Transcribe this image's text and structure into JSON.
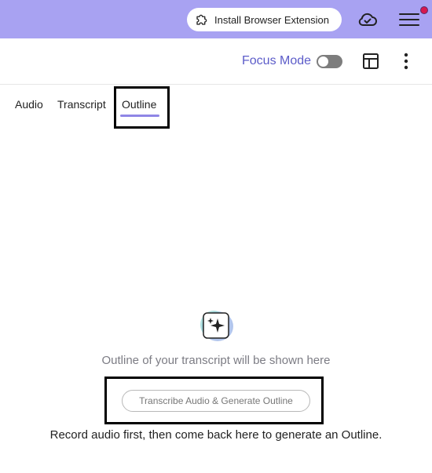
{
  "topbar": {
    "extension_button_label": "Install Browser Extension",
    "colors": {
      "background": "#a8a2f2",
      "notification_dot": "#d6184e"
    }
  },
  "toolbar": {
    "focus_mode_label": "Focus Mode",
    "focus_mode_enabled": false,
    "accent_color": "#5c5cc9"
  },
  "tabs": {
    "items": [
      {
        "label": "Audio",
        "active": false
      },
      {
        "label": "Transcript",
        "active": false
      },
      {
        "label": "Outline",
        "active": true
      }
    ],
    "active_underline_color": "#8f86e6"
  },
  "outline": {
    "empty_message": "Outline of your transcript will be shown here",
    "generate_button_label": "Transcribe Audio & Generate Outline",
    "hint": "Record audio first, then come back here to generate an Outline."
  },
  "icons": {
    "extension": "puzzle-icon",
    "cloud": "cloud-check-icon",
    "menu": "hamburger-menu-icon",
    "layout": "layout-panel-icon",
    "more": "more-vertical-icon",
    "sparkle": "sparkle-icon"
  }
}
